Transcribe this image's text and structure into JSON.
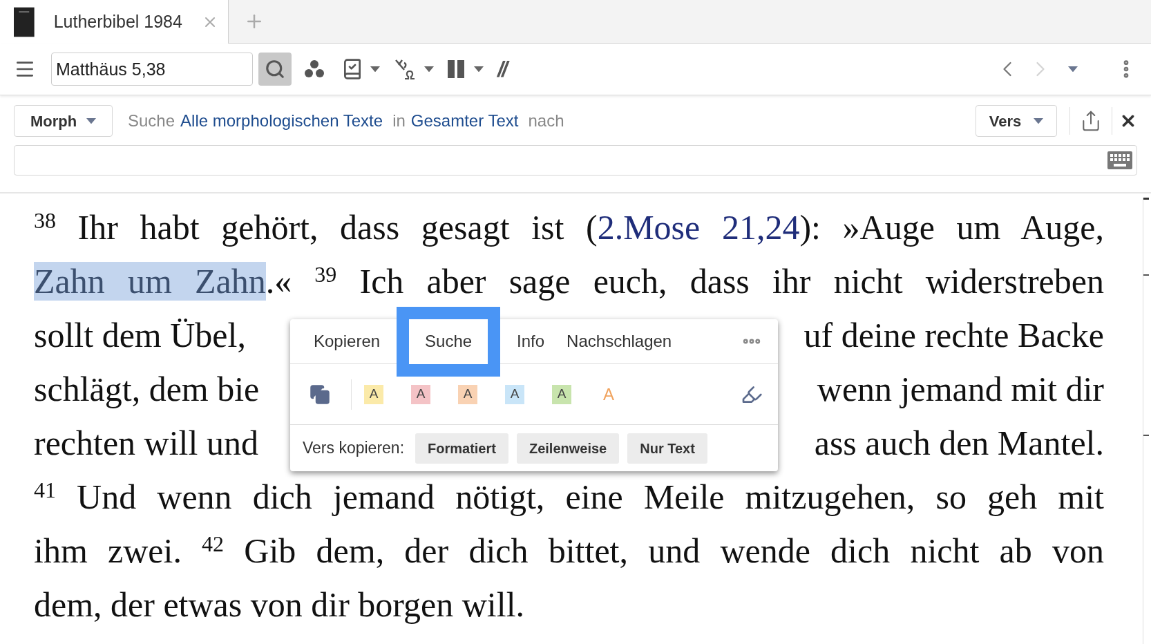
{
  "tab": {
    "title": "Lutherbibel 1984"
  },
  "toolbar": {
    "reference": "Matthäus 5,38",
    "parallel": "//",
    "forward_disabled": true
  },
  "search_panel": {
    "mode": "Morph",
    "query": [
      {
        "kind": "plain",
        "text": "Suche"
      },
      {
        "kind": "link",
        "text": "Alle morphologischen Texte"
      },
      {
        "kind": "plain",
        "text": "in"
      },
      {
        "kind": "link",
        "text": "Gesamter Text"
      },
      {
        "kind": "plain",
        "text": "nach"
      }
    ],
    "scope": "Vers"
  },
  "passage": {
    "lines": [
      {
        "parts": [
          [
            {
              "kind": "verse",
              "text": "38"
            },
            {
              "kind": "text",
              "text": " Ihr habt gehört, dass gesagt ist ("
            },
            {
              "kind": "link",
              "text": "2.Mose 21,24"
            },
            {
              "kind": "text",
              "text": "): »Auge um Auge,"
            }
          ]
        ]
      },
      {
        "parts": [
          [
            {
              "kind": "selected",
              "text": "Zahn um Zahn"
            },
            {
              "kind": "text",
              "text": ".« "
            },
            {
              "kind": "verse",
              "text": "39"
            },
            {
              "kind": "text",
              "text": " Ich aber sage euch, dass ihr nicht widerstreben"
            }
          ]
        ]
      },
      {
        "parts": [
          [
            {
              "kind": "text",
              "text": "sollt dem Übel,"
            }
          ],
          [
            {
              "kind": "text",
              "text": "uf deine rechte Backe"
            }
          ]
        ]
      },
      {
        "parts": [
          [
            {
              "kind": "text",
              "text": "schlägt, dem bie"
            }
          ],
          [
            {
              "kind": "text",
              "text": "wenn jemand mit dir"
            }
          ]
        ]
      },
      {
        "parts": [
          [
            {
              "kind": "text",
              "text": "rechten will und"
            }
          ],
          [
            {
              "kind": "text",
              "text": "ass auch den Mantel."
            }
          ]
        ]
      },
      {
        "parts": [
          [
            {
              "kind": "verse",
              "text": "41"
            },
            {
              "kind": "text",
              "text": " Und wenn dich jemand nötigt, eine Meile mitzugehen, so geh mit"
            }
          ]
        ]
      },
      {
        "parts": [
          [
            {
              "kind": "text",
              "text": "ihm zwei. "
            },
            {
              "kind": "verse",
              "text": "42"
            },
            {
              "kind": "text",
              "text": " Gib dem, der dich bittet, und wende dich nicht ab von"
            }
          ]
        ]
      },
      {
        "parts": [
          [
            {
              "kind": "text",
              "text": "dem, der etwas von dir borgen will."
            }
          ]
        ]
      }
    ]
  },
  "popup": {
    "tabs": [
      {
        "label": "Kopieren",
        "selected": false
      },
      {
        "label": "Suche",
        "selected": true
      },
      {
        "label": "Info",
        "selected": false
      },
      {
        "label": "Nachschlagen",
        "selected": false
      }
    ],
    "highlight_styles": [
      {
        "label": "A",
        "kind": "fill",
        "color": "#fbeaa9"
      },
      {
        "label": "A",
        "kind": "fill",
        "color": "#f4c3c6"
      },
      {
        "label": "A",
        "kind": "fill",
        "color": "#f9d2b3"
      },
      {
        "label": "A",
        "kind": "fill",
        "color": "#c9e5f8"
      },
      {
        "label": "A",
        "kind": "fill",
        "color": "#c8e4ad"
      },
      {
        "label": "A",
        "kind": "text",
        "color": "#f0a35e"
      }
    ],
    "copy_label": "Vers kopieren:",
    "copy_buttons": [
      "Formatiert",
      "Zeilenweise",
      "Nur Text"
    ]
  }
}
